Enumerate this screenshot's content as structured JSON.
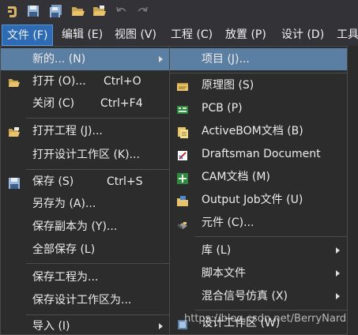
{
  "toolbar": {
    "icons": [
      "app-logo-icon",
      "save-icon",
      "save-all-icon",
      "open-folder-icon",
      "open-project-icon",
      "undo-icon",
      "redo-icon"
    ]
  },
  "menubar": {
    "items": [
      {
        "label": "文件 (F)"
      },
      {
        "label": "编辑 (E)"
      },
      {
        "label": "视图 (V)"
      },
      {
        "label": "工程 (C)"
      },
      {
        "label": "放置 (P)"
      },
      {
        "label": "设计 (D)"
      },
      {
        "label": "工具"
      }
    ]
  },
  "file_menu": {
    "items": [
      {
        "label": "新的... (N)",
        "shortcut": "",
        "submenu": true,
        "highlighted": true,
        "icon": ""
      },
      {
        "label": "打开 (O)...",
        "shortcut": "Ctrl+O",
        "submenu": false,
        "icon": "open-folder-icon"
      },
      {
        "label": "关闭 (C)",
        "shortcut": "Ctrl+F4",
        "submenu": false,
        "icon": ""
      },
      {
        "label": "打开工程 (J)...",
        "shortcut": "",
        "submenu": false,
        "icon": "open-project-icon"
      },
      {
        "label": "打开设计工作区 (K)...",
        "shortcut": "",
        "submenu": false,
        "icon": ""
      },
      {
        "label": "保存 (S)",
        "shortcut": "Ctrl+S",
        "submenu": false,
        "icon": "save-icon"
      },
      {
        "label": "另存为 (A)...",
        "shortcut": "",
        "submenu": false,
        "icon": ""
      },
      {
        "label": "保存副本为 (Y)...",
        "shortcut": "",
        "submenu": false,
        "icon": ""
      },
      {
        "label": "全部保存 (L)",
        "shortcut": "",
        "submenu": false,
        "icon": ""
      },
      {
        "label": "保存工程为...",
        "shortcut": "",
        "submenu": false,
        "icon": ""
      },
      {
        "label": "保存设计工作区为...",
        "shortcut": "",
        "submenu": false,
        "icon": ""
      },
      {
        "label": "导入 (I)",
        "shortcut": "",
        "submenu": true,
        "icon": ""
      }
    ]
  },
  "new_submenu": {
    "items": [
      {
        "label": "项目 (J)...",
        "submenu": false,
        "highlighted": true,
        "icon": ""
      },
      {
        "label": "原理图 (S)",
        "submenu": false,
        "icon": "schematic-icon"
      },
      {
        "label": "PCB (P)",
        "submenu": false,
        "icon": "pcb-icon"
      },
      {
        "label": "ActiveBOM文档 (B)",
        "submenu": false,
        "icon": "bom-icon"
      },
      {
        "label": "Draftsman Document",
        "submenu": false,
        "icon": "draftsman-icon"
      },
      {
        "label": "CAM文档 (M)",
        "submenu": false,
        "icon": "cam-icon"
      },
      {
        "label": "Output Job文件 (U)",
        "submenu": false,
        "icon": "output-job-icon"
      },
      {
        "label": "元件 (C)...",
        "submenu": false,
        "icon": "component-icon"
      },
      {
        "label": "库 (L)",
        "submenu": true,
        "icon": ""
      },
      {
        "label": "脚本文件",
        "submenu": true,
        "icon": ""
      },
      {
        "label": "混合信号仿真 (X)",
        "submenu": true,
        "icon": ""
      },
      {
        "label": "设计工作区 (W)",
        "submenu": false,
        "icon": "workspace-icon"
      }
    ]
  },
  "watermark": "https://blog.csdn.net/BerryNard",
  "colors": {
    "highlight": "#5b7ea3",
    "menubar_active": "#2d6bb5",
    "menu_bg": "#2c2c2c",
    "toolbar_bg": "#333337"
  }
}
